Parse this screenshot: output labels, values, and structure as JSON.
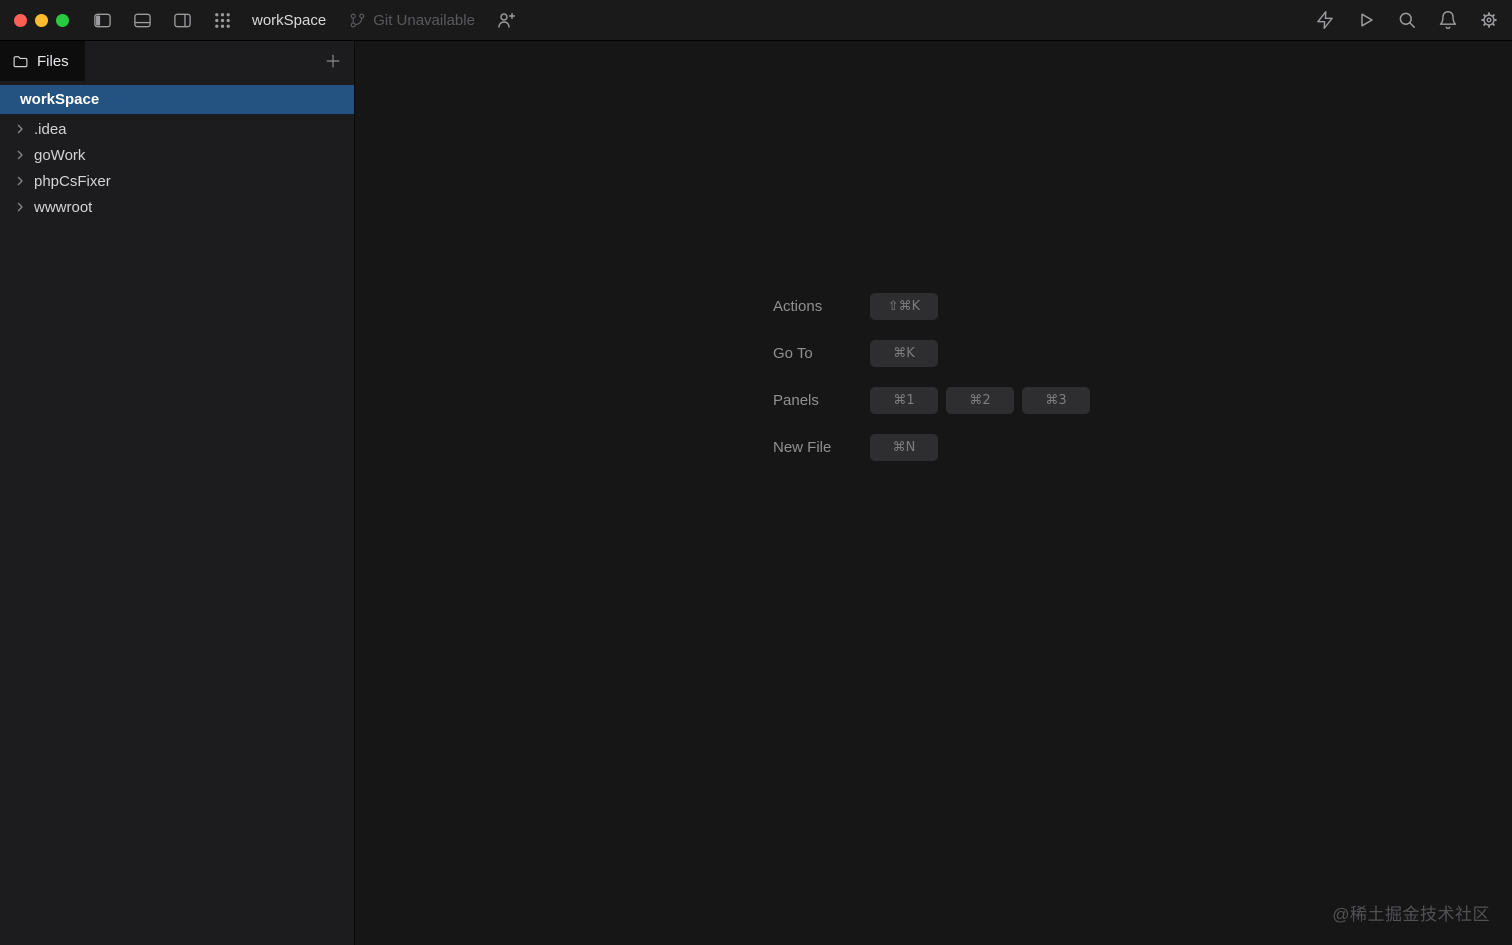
{
  "titlebar": {
    "title": "workSpace",
    "git_status": "Git Unavailable",
    "window_controls": [
      "close",
      "minimize",
      "zoom"
    ],
    "left_icons": [
      "layout-left-panel",
      "layout-bottom-panel",
      "layout-right-panel",
      "app-grid",
      "git-branch",
      "person-add"
    ],
    "right_icons": [
      "lightning",
      "run",
      "search",
      "notifications",
      "settings"
    ]
  },
  "sidebar": {
    "tab_label": "Files",
    "tree": {
      "root": "workSpace",
      "items": [
        ".idea",
        "goWork",
        "phpCsFixer",
        "wwwroot"
      ]
    }
  },
  "main": {
    "shortcuts": [
      {
        "label": "Actions",
        "keys": [
          "⇧⌘K"
        ]
      },
      {
        "label": "Go To",
        "keys": [
          "⌘K"
        ]
      },
      {
        "label": "Panels",
        "keys": [
          "⌘1",
          "⌘2",
          "⌘3"
        ]
      },
      {
        "label": "New File",
        "keys": [
          "⌘N"
        ]
      }
    ]
  },
  "watermark": "@稀土掘金技术社区",
  "colors": {
    "selection_blue": "#245381",
    "traffic_red": "#ff5f57",
    "traffic_yellow": "#febc2e",
    "traffic_green": "#28c840",
    "kbd_background": "#2e2e30"
  }
}
